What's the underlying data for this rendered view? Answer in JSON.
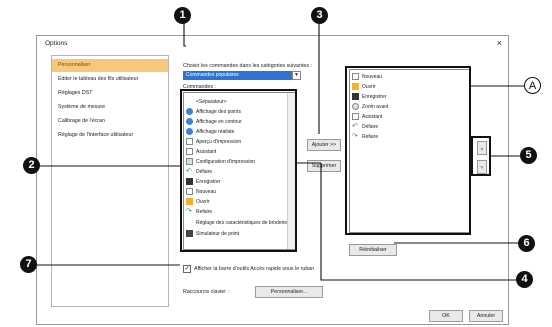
{
  "dialog": {
    "title": "Options",
    "close_label": "×"
  },
  "sidebar": {
    "items": [
      {
        "label": "Personnaliser",
        "selected": true
      },
      {
        "label": "Éditer le tableau des fils utilisateur",
        "selected": false
      },
      {
        "label": "Réglages DST",
        "selected": false
      },
      {
        "label": "Système de mesure",
        "selected": false
      },
      {
        "label": "Calibrage de l'écran",
        "selected": false
      },
      {
        "label": "Réglage de l'interface utilisateur",
        "selected": false
      }
    ]
  },
  "main": {
    "choose_label": "Choisir les commandes dans les catégories suivantes :",
    "category_value": "Commandes populaires",
    "commands_label": "Commandes :",
    "commands": [
      {
        "label": "<Séparateur>",
        "icon": "none"
      },
      {
        "label": "Affichage des points",
        "icon": "point-icon"
      },
      {
        "label": "Affichage en contour",
        "icon": "outline-icon"
      },
      {
        "label": "Affichage réaliste",
        "icon": "realistic-icon"
      },
      {
        "label": "Aperçu d'impression",
        "icon": "print-preview-icon"
      },
      {
        "label": "Assistant",
        "icon": "wizard-icon"
      },
      {
        "label": "Configuration d'impression",
        "icon": "print-setup-icon"
      },
      {
        "label": "Défaire",
        "icon": "undo-icon"
      },
      {
        "label": "Enregistrer",
        "icon": "save-icon"
      },
      {
        "label": "Nouveau",
        "icon": "new-icon"
      },
      {
        "label": "Ouvrir",
        "icon": "open-icon"
      },
      {
        "label": "Refaire",
        "icon": "redo-icon"
      },
      {
        "label": "Réglage des caractéristiques de broderie",
        "icon": "none"
      },
      {
        "label": "Simulateur de point",
        "icon": "simulator-icon"
      }
    ],
    "add_label": "Ajouter >>",
    "remove_label": "Supprimer",
    "toolbar_items": [
      {
        "label": "Nouveau",
        "icon": "new-icon"
      },
      {
        "label": "Ouvrir",
        "icon": "open-icon"
      },
      {
        "label": "Enregistrer",
        "icon": "save-icon"
      },
      {
        "label": "Zoom avant",
        "icon": "zoom-icon"
      },
      {
        "label": "Assistant",
        "icon": "wizard-icon"
      },
      {
        "label": "Défaire",
        "icon": "undo-icon"
      },
      {
        "label": "Refaire",
        "icon": "redo-icon"
      }
    ],
    "reset_label": "Réinitialiser",
    "show_below_label": "Afficher la barre d'outils Accès rapide sous le ruban",
    "shortcuts_label": "Raccourcis clavier :",
    "customize_label": "Personnaliser...",
    "ok_label": "OK",
    "cancel_label": "Annuler"
  },
  "callouts": {
    "c1": "1",
    "c2": "2",
    "c3": "3",
    "c4": "4",
    "c5": "5",
    "c6": "6",
    "c7": "7",
    "cA": "A"
  }
}
